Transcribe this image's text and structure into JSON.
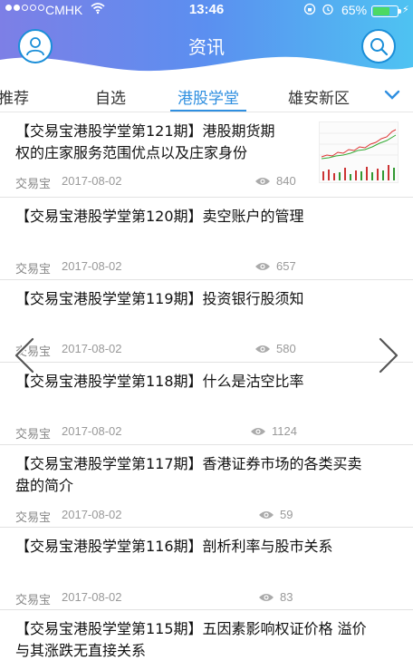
{
  "status_bar": {
    "carrier": "CMHK",
    "time": "13:46",
    "battery": "65%",
    "battery_level": 0.65
  },
  "header": {
    "title": "资讯",
    "left_icon": "user-icon",
    "right_icon": "search-icon"
  },
  "tabs": [
    {
      "label": "推荐",
      "active": false
    },
    {
      "label": "自选",
      "active": false
    },
    {
      "label": "港股学堂",
      "active": true
    },
    {
      "label": "雄安新区",
      "active": false
    }
  ],
  "articles": [
    {
      "title_line1": "【交易宝港股学堂第121期】港股期货期",
      "title_line2": "权的庄家服务范围优点以及庄家身份",
      "source": "交易宝",
      "date": "2017-08-02",
      "views": "840",
      "has_thumbnail": true
    },
    {
      "title_line1": "【交易宝港股学堂第120期】卖空账户的管理",
      "title_line2": "",
      "source": "交易宝",
      "date": "2017-08-02",
      "views": "657"
    },
    {
      "title_line1": "【交易宝港股学堂第119期】投资银行股须知",
      "title_line2": "",
      "source": "交易宝",
      "date": "2017-08-02",
      "views": "580"
    },
    {
      "title_line1": "【交易宝港股学堂第118期】什么是沽空比率",
      "title_line2": "",
      "source": "交易宝",
      "date": "2017-08-02",
      "views": "1124"
    },
    {
      "title_line1": "【交易宝港股学堂第117期】香港证券市场的各类买卖",
      "title_line2": "盘的简介",
      "source": "交易宝",
      "date": "2017-08-02",
      "views": "59"
    },
    {
      "title_line1": "【交易宝港股学堂第116期】剖析利率与股市关系",
      "title_line2": "",
      "source": "交易宝",
      "date": "2017-08-02",
      "views": "83"
    },
    {
      "title_line1": "【交易宝港股学堂第115期】五因素影响权证价格 溢价",
      "title_line2": "与其涨跌无直接关系",
      "source": "",
      "date": "",
      "views": ""
    }
  ],
  "colors": {
    "accent": "#2f8fe0",
    "header_start": "#7d7fe6",
    "header_end": "#4ec3f2"
  }
}
